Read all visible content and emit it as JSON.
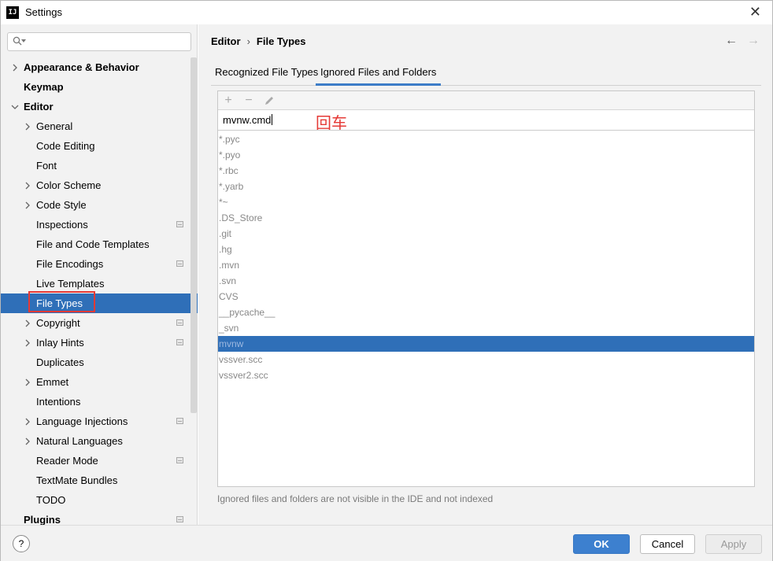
{
  "window": {
    "title": "Settings",
    "app_logo": "IJ"
  },
  "search": {
    "placeholder": ""
  },
  "sidebar": {
    "items": [
      {
        "label": "Appearance & Behavior",
        "bold": true,
        "expander": "right",
        "indent": 0,
        "badge": false
      },
      {
        "label": "Keymap",
        "bold": true,
        "expander": "",
        "indent": 0,
        "badge": false
      },
      {
        "label": "Editor",
        "bold": true,
        "expander": "down",
        "indent": 0,
        "badge": false
      },
      {
        "label": "General",
        "bold": false,
        "expander": "right",
        "indent": 1,
        "badge": false
      },
      {
        "label": "Code Editing",
        "bold": false,
        "expander": "",
        "indent": 1,
        "badge": false
      },
      {
        "label": "Font",
        "bold": false,
        "expander": "",
        "indent": 1,
        "badge": false
      },
      {
        "label": "Color Scheme",
        "bold": false,
        "expander": "right",
        "indent": 1,
        "badge": false
      },
      {
        "label": "Code Style",
        "bold": false,
        "expander": "right",
        "indent": 1,
        "badge": false
      },
      {
        "label": "Inspections",
        "bold": false,
        "expander": "",
        "indent": 1,
        "badge": true
      },
      {
        "label": "File and Code Templates",
        "bold": false,
        "expander": "",
        "indent": 1,
        "badge": false
      },
      {
        "label": "File Encodings",
        "bold": false,
        "expander": "",
        "indent": 1,
        "badge": true
      },
      {
        "label": "Live Templates",
        "bold": false,
        "expander": "",
        "indent": 1,
        "badge": false
      },
      {
        "label": "File Types",
        "bold": false,
        "expander": "",
        "indent": 1,
        "badge": false,
        "selected": true
      },
      {
        "label": "Copyright",
        "bold": false,
        "expander": "right",
        "indent": 1,
        "badge": true
      },
      {
        "label": "Inlay Hints",
        "bold": false,
        "expander": "right",
        "indent": 1,
        "badge": true
      },
      {
        "label": "Duplicates",
        "bold": false,
        "expander": "",
        "indent": 1,
        "badge": false
      },
      {
        "label": "Emmet",
        "bold": false,
        "expander": "right",
        "indent": 1,
        "badge": false
      },
      {
        "label": "Intentions",
        "bold": false,
        "expander": "",
        "indent": 1,
        "badge": false
      },
      {
        "label": "Language Injections",
        "bold": false,
        "expander": "right",
        "indent": 1,
        "badge": true
      },
      {
        "label": "Natural Languages",
        "bold": false,
        "expander": "right",
        "indent": 1,
        "badge": false
      },
      {
        "label": "Reader Mode",
        "bold": false,
        "expander": "",
        "indent": 1,
        "badge": true
      },
      {
        "label": "TextMate Bundles",
        "bold": false,
        "expander": "",
        "indent": 1,
        "badge": false
      },
      {
        "label": "TODO",
        "bold": false,
        "expander": "",
        "indent": 1,
        "badge": false
      },
      {
        "label": "Plugins",
        "bold": true,
        "expander": "",
        "indent": 0,
        "badge": true
      }
    ]
  },
  "breadcrumb": {
    "parent": "Editor",
    "separator": "›",
    "current": "File Types"
  },
  "nav": {
    "back": "←",
    "forward": "→"
  },
  "tabs": [
    {
      "label": "Recognized File Types",
      "active": false
    },
    {
      "label": "Ignored Files and Folders",
      "active": true
    }
  ],
  "toolbar": {
    "add": "+",
    "remove": "−"
  },
  "editor": {
    "value": "mvnw.cmd",
    "annotation": "回车"
  },
  "ignored_list": [
    {
      "label": "*.pyc",
      "selected": false
    },
    {
      "label": "*.pyo",
      "selected": false
    },
    {
      "label": "*.rbc",
      "selected": false
    },
    {
      "label": "*.yarb",
      "selected": false
    },
    {
      "label": "*~",
      "selected": false
    },
    {
      "label": ".DS_Store",
      "selected": false
    },
    {
      "label": ".git",
      "selected": false
    },
    {
      "label": ".hg",
      "selected": false
    },
    {
      "label": ".mvn",
      "selected": false
    },
    {
      "label": ".svn",
      "selected": false
    },
    {
      "label": "CVS",
      "selected": false
    },
    {
      "label": "__pycache__",
      "selected": false
    },
    {
      "label": "_svn",
      "selected": false
    },
    {
      "label": "mvnw",
      "selected": true
    },
    {
      "label": "vssver.scc",
      "selected": false
    },
    {
      "label": "vssver2.scc",
      "selected": false
    }
  ],
  "note": "Ignored files and folders are not visible in the IDE and not indexed",
  "footer": {
    "help": "?",
    "ok": "OK",
    "cancel": "Cancel",
    "apply": "Apply"
  },
  "colors": {
    "selection": "#2f6fb8",
    "accent": "#3d80cf",
    "annotation": "#e53935"
  }
}
